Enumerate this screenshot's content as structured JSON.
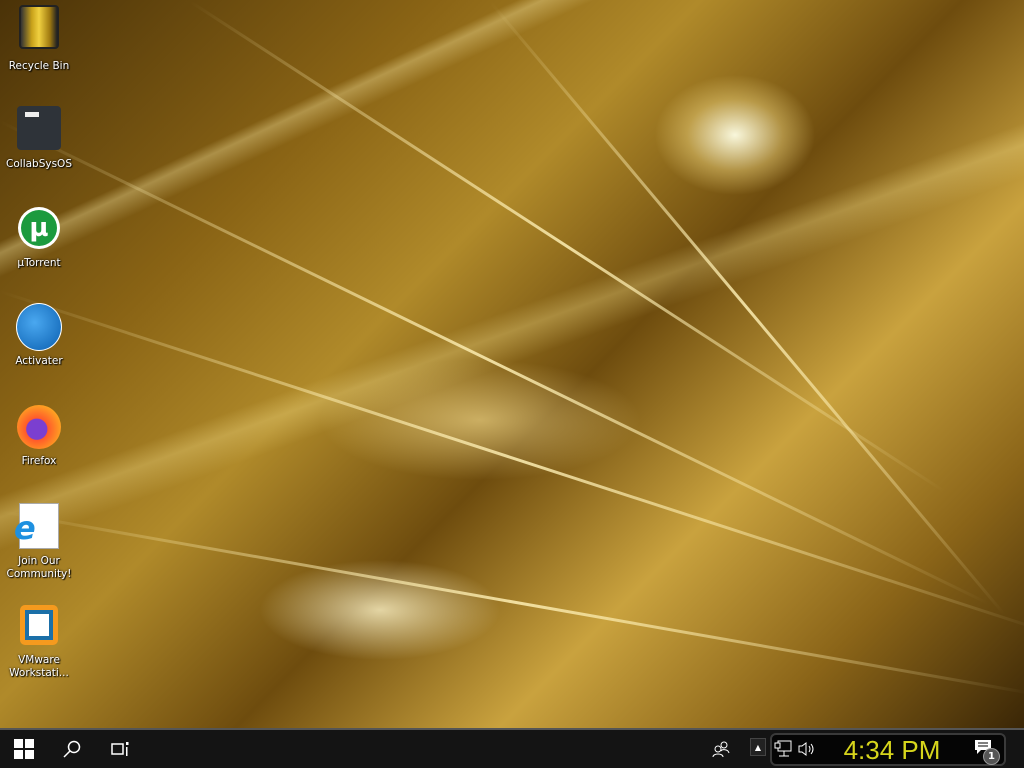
{
  "desktop": {
    "icons": [
      {
        "label": "Recycle Bin",
        "icon": "recycle-bin-icon"
      },
      {
        "label": "CollabSysOS",
        "icon": "folder-icon"
      },
      {
        "label": "µTorrent",
        "icon": "utorrent-icon"
      },
      {
        "label": "Activater",
        "icon": "activator-icon"
      },
      {
        "label": "Firefox",
        "icon": "firefox-icon"
      },
      {
        "label": "Join Our Community!",
        "icon": "internet-explorer-icon"
      },
      {
        "label": "VMware Workstati...",
        "icon": "vmware-icon"
      }
    ]
  },
  "taskbar": {
    "clock": "4:34 PM",
    "notification_count": "1"
  }
}
